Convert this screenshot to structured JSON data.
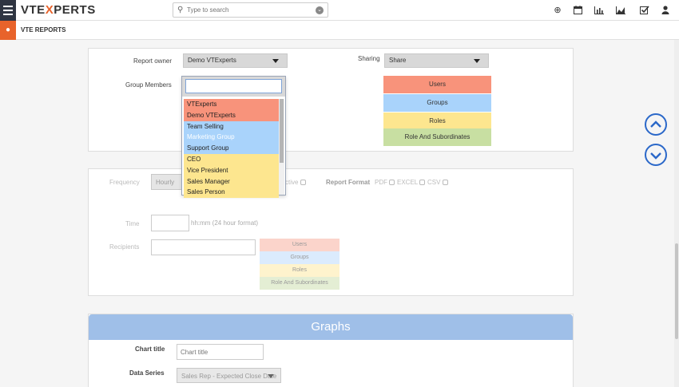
{
  "header": {
    "logo_prefix": "VTE",
    "logo_x": "X",
    "logo_suffix": "PERTS",
    "search_placeholder": "Type to search",
    "module_title": "VTE REPORTS"
  },
  "sharing_panel": {
    "report_owner_label": "Report owner",
    "report_owner_value": "Demo VTExperts",
    "group_members_label": "Group Members",
    "group_members_input": "",
    "sharing_label": "Sharing",
    "sharing_value": "Share",
    "share_buttons": [
      "Users",
      "Groups",
      "Roles",
      "Role And Subordinates"
    ],
    "dropdown_options": [
      "VTExperts",
      "Demo VTExperts",
      "Team Selling",
      "Marketing Group",
      "Support Group",
      "CEO",
      "Vice President",
      "Sales Manager",
      "Sales Person"
    ]
  },
  "schedule_panel": {
    "frequency_label": "Frequency",
    "frequency_value": "Hourly",
    "active_label": "ctive",
    "report_format_label": "Report Format",
    "formats": [
      "PDF",
      "EXCEL",
      "CSV"
    ],
    "time_label": "Time",
    "time_hint": "hh:mm (24 hour format)",
    "recipients_label": "Recipients",
    "recipient_buttons": [
      "Users",
      "Groups",
      "Roles",
      "Role And Subordinates"
    ]
  },
  "graphs_panel": {
    "title": "Graphs",
    "chart_title_label": "Chart title",
    "chart_title_placeholder": "Chart title",
    "data_series_label": "Data Series",
    "data_series_value": "Sales Rep - Expected Close Date"
  },
  "colors": {
    "orange": "#e8632b",
    "users": "#f8937b",
    "groups": "#a9d3fb",
    "roles": "#fde68f",
    "role_sub": "#c8dfa2",
    "graphs_bar": "#9fbfe8"
  }
}
